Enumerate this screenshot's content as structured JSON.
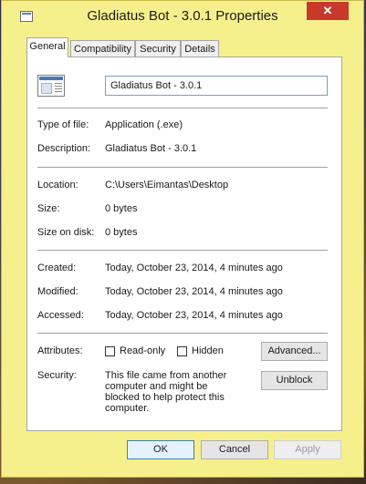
{
  "window": {
    "title": "Gladiatus Bot - 3.0.1 Properties",
    "close_glyph": "✕"
  },
  "tabs": [
    {
      "label": "General",
      "active": true
    },
    {
      "label": "Compatibility",
      "active": false
    },
    {
      "label": "Security",
      "active": false
    },
    {
      "label": "Details",
      "active": false
    }
  ],
  "general": {
    "file_name": "Gladiatus Bot - 3.0.1",
    "type_label": "Type of file:",
    "type_value": "Application (.exe)",
    "description_label": "Description:",
    "description_value": "Gladiatus Bot - 3.0.1",
    "location_label": "Location:",
    "location_value": "C:\\Users\\Eimantas\\Desktop",
    "size_label": "Size:",
    "size_value": "0 bytes",
    "size_on_disk_label": "Size on disk:",
    "size_on_disk_value": "0 bytes",
    "created_label": "Created:",
    "created_value": "Today, October 23, 2014, 4 minutes ago",
    "modified_label": "Modified:",
    "modified_value": "Today, October 23, 2014, 4 minutes ago",
    "accessed_label": "Accessed:",
    "accessed_value": "Today, October 23, 2014, 4 minutes ago",
    "attributes_label": "Attributes:",
    "readonly_label": "Read-only",
    "readonly_checked": false,
    "hidden_label": "Hidden",
    "hidden_checked": false,
    "advanced_button": "Advanced...",
    "security_label": "Security:",
    "security_text": "This file came from another computer and might be blocked to help protect this computer.",
    "unblock_button": "Unblock"
  },
  "footer": {
    "ok": "OK",
    "cancel": "Cancel",
    "apply": "Apply"
  },
  "colors": {
    "window_frame": "#f6f08c",
    "close_button": "#c7392b"
  }
}
